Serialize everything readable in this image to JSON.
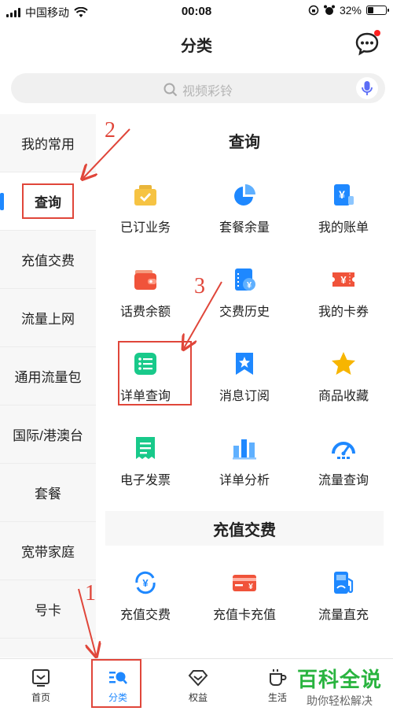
{
  "status_bar": {
    "carrier": "中国移动",
    "time": "00:08",
    "battery_text": "32%",
    "battery_level": 0.32
  },
  "header": {
    "title": "分类"
  },
  "search": {
    "placeholder": "视频彩铃"
  },
  "sidebar": {
    "items": [
      {
        "label": "我的常用"
      },
      {
        "label": "查询"
      },
      {
        "label": "充值交费"
      },
      {
        "label": "流量上网"
      },
      {
        "label": "通用流量包"
      },
      {
        "label": "国际/港澳台"
      },
      {
        "label": "套餐"
      },
      {
        "label": "宽带家庭"
      },
      {
        "label": "号卡"
      }
    ]
  },
  "sections": [
    {
      "title": "查询",
      "items": [
        {
          "label": "已订业务",
          "icon": "briefcase-icon"
        },
        {
          "label": "套餐余量",
          "icon": "pie-chart-icon"
        },
        {
          "label": "我的账单",
          "icon": "bill-icon"
        },
        {
          "label": "话费余额",
          "icon": "wallet-icon"
        },
        {
          "label": "交费历史",
          "icon": "payment-history-icon"
        },
        {
          "label": "我的卡券",
          "icon": "coupon-icon"
        },
        {
          "label": "详单查询",
          "icon": "list-icon"
        },
        {
          "label": "消息订阅",
          "icon": "bookmark-star-icon"
        },
        {
          "label": "商品收藏",
          "icon": "star-icon"
        },
        {
          "label": "电子发票",
          "icon": "invoice-icon"
        },
        {
          "label": "详单分析",
          "icon": "bar-chart-icon"
        },
        {
          "label": "流量查询",
          "icon": "gauge-icon"
        }
      ]
    },
    {
      "title": "充值交费",
      "items": [
        {
          "label": "充值交费",
          "icon": "yuan-refresh-icon"
        },
        {
          "label": "充值卡充值",
          "icon": "card-icon"
        },
        {
          "label": "流量直充",
          "icon": "fuel-icon"
        }
      ]
    }
  ],
  "tabbar": {
    "tabs": [
      {
        "label": "首页"
      },
      {
        "label": "分类"
      },
      {
        "label": "权益"
      },
      {
        "label": "生活"
      }
    ]
  },
  "watermark": {
    "main": "百科全说",
    "sub": "助你轻松解决"
  },
  "annotations": {
    "a1": "1",
    "a2": "2",
    "a3": "3"
  },
  "colors": {
    "accent": "#1e88ff",
    "annotation": "#e0463a",
    "watermark": "#29b43f"
  }
}
